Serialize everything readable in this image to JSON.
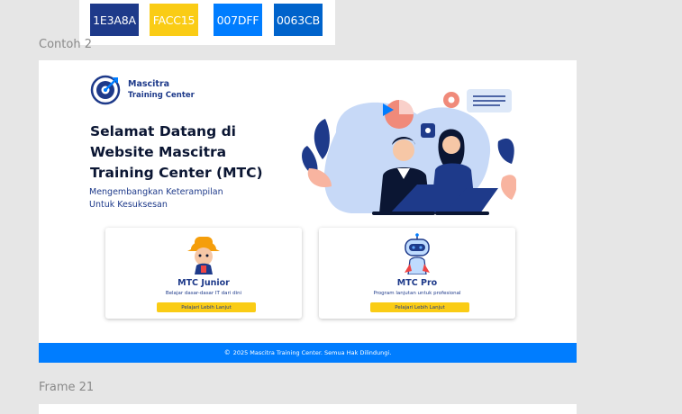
{
  "palette": [
    {
      "hex_label": "1E3A8A",
      "color": "#1E3A8A"
    },
    {
      "hex_label": "FACC15",
      "color": "#FACC15"
    },
    {
      "hex_label": "007DFF",
      "color": "#007DFF"
    },
    {
      "hex_label": "0063CB",
      "color": "#0063CB"
    }
  ],
  "frames": {
    "frame1_label": "Contoh 2",
    "frame2_label": "Frame 21"
  },
  "site": {
    "logo_line1": "Mascitra",
    "logo_line2": "Training Center",
    "hero_title": "Selamat Datang di\nWebsite Mascitra\nTraining Center (MTC)",
    "hero_subtitle": "Mengembangkan Keterampilan\nUntuk Kesuksesan",
    "cards": [
      {
        "title": "MTC Junior",
        "desc": "Belajar dasar-dasar IT dari dini",
        "button": "Pelajari Lebih Lanjut"
      },
      {
        "title": "MTC Pro",
        "desc": "Program lanjutan untuk profesional",
        "button": "Pelajari Lebih Lanjut"
      }
    ],
    "footer_copy_symbol": "©",
    "footer_text": "2025 Mascitra Training Center. Semua Hak Dilindungi."
  },
  "icons": [
    "mascitra-logo-icon",
    "hero-illustration",
    "junior-mascot-icon",
    "pro-robot-mascot-icon",
    "copyright-icon"
  ]
}
